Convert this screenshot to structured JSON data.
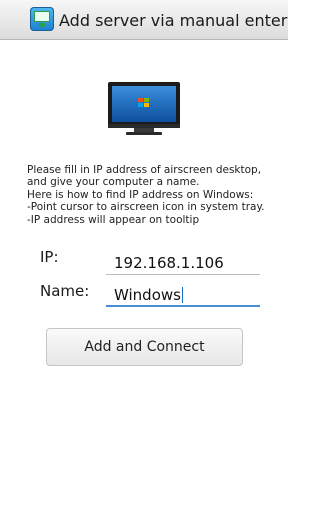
{
  "header": {
    "title": "Add server via manual enter",
    "icon": "airscreen-app-icon"
  },
  "illustration": {
    "icon": "windows-monitor-icon"
  },
  "instructions": {
    "lines": [
      "Please fill in IP address of airscreen desktop,",
      "and give your computer a name.",
      "Here is how to find IP address on Windows:",
      " -Point cursor to airscreen icon in system tray.",
      " -IP address will appear on tooltip"
    ]
  },
  "form": {
    "ip_label": "IP:",
    "ip_value": "192.168.1.106",
    "name_label": "Name:",
    "name_value": "Windows"
  },
  "actions": {
    "connect_label": "Add and Connect"
  },
  "colors": {
    "accent": "#4a8fd6",
    "title_bar": "#e4e4e4"
  }
}
